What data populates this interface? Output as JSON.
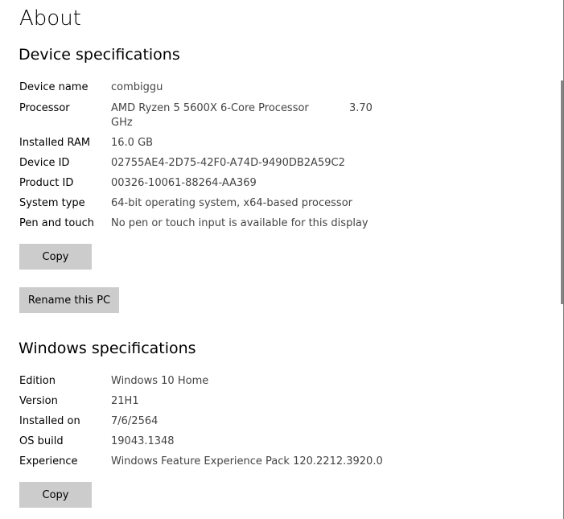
{
  "page": {
    "title": "About"
  },
  "device_specs": {
    "heading": "Device specifications",
    "rows": [
      {
        "label": "Device name",
        "value": "combiggu"
      },
      {
        "label": "Processor",
        "value": "AMD Ryzen 5 5600X 6-Core Processor",
        "value_speed": "3.70",
        "value_cont": "GHz"
      },
      {
        "label": "Installed RAM",
        "value": "16.0 GB"
      },
      {
        "label": "Device ID",
        "value": "02755AE4-2D75-42F0-A74D-9490DB2A59C2"
      },
      {
        "label": "Product ID",
        "value": "00326-10061-88264-AA369"
      },
      {
        "label": "System type",
        "value": "64-bit operating system, x64-based processor"
      },
      {
        "label": "Pen and touch",
        "value": "No pen or touch input is available for this display"
      }
    ],
    "copy_label": "Copy",
    "rename_label": "Rename this PC"
  },
  "windows_specs": {
    "heading": "Windows specifications",
    "rows": [
      {
        "label": "Edition",
        "value": "Windows 10 Home"
      },
      {
        "label": "Version",
        "value": "21H1"
      },
      {
        "label": "Installed on",
        "value": "7/6/2564"
      },
      {
        "label": "OS build",
        "value": "19043.1348"
      },
      {
        "label": "Experience",
        "value": "Windows Feature Experience Pack 120.2212.3920.0"
      }
    ],
    "copy_label": "Copy"
  },
  "colors": {
    "button_bg": "#cccccc",
    "value_text": "#444444",
    "scrollbar_thumb": "#858585"
  }
}
